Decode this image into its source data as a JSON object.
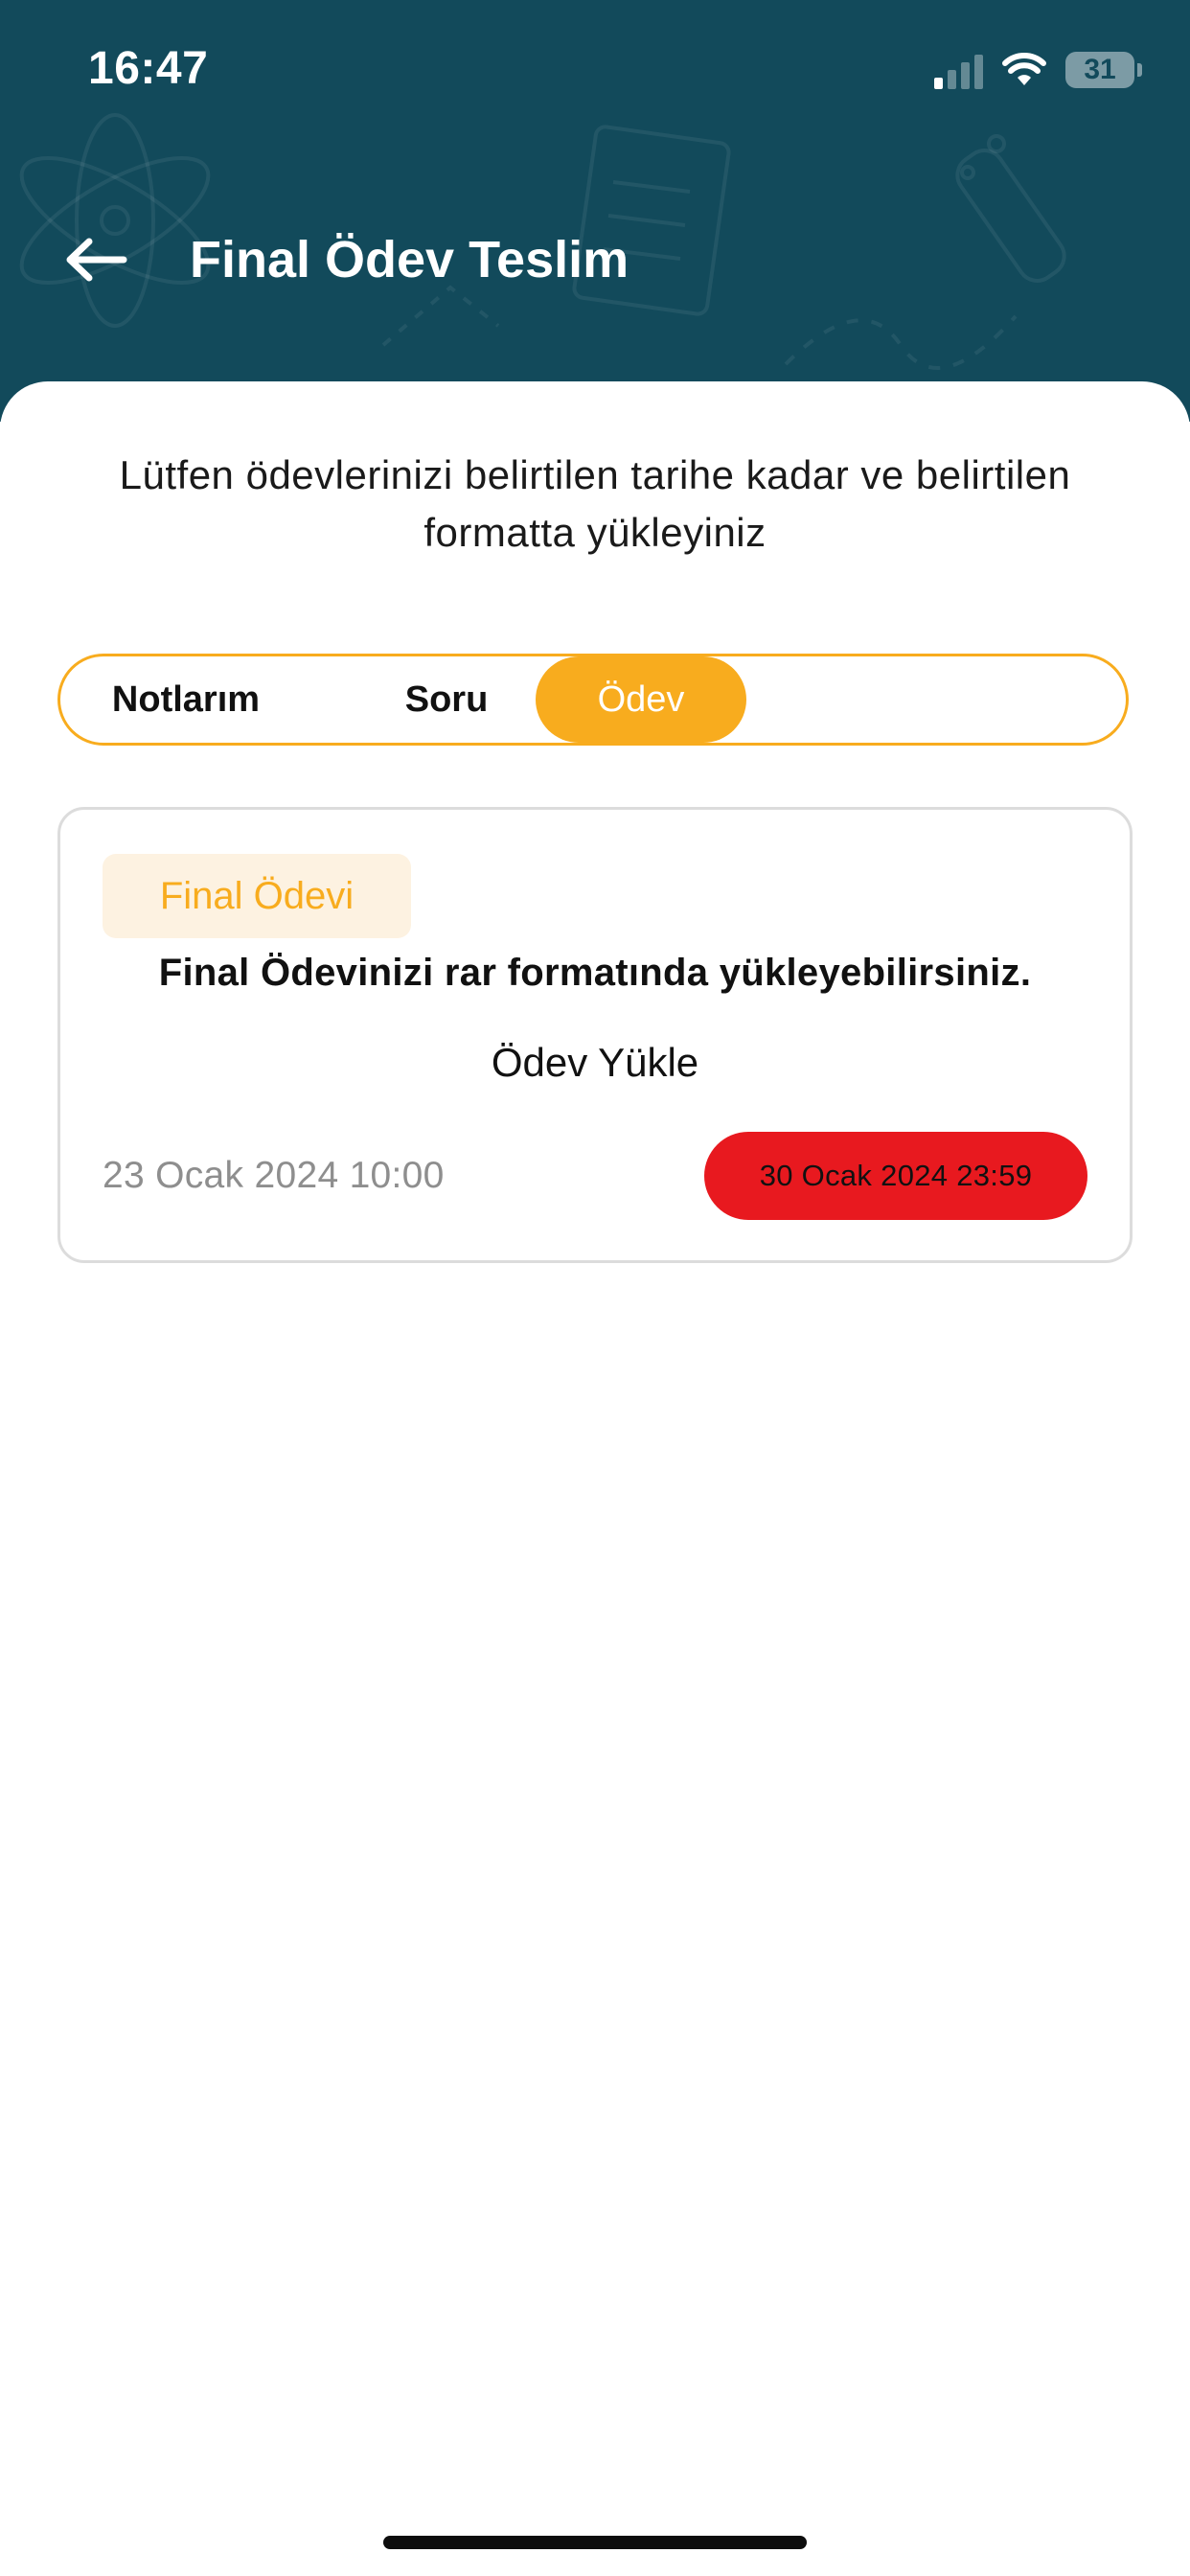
{
  "status_bar": {
    "time": "16:47",
    "battery": "31",
    "battery_level": 0.31,
    "signal_bars_on": 1,
    "signal_bars_total": 4
  },
  "header": {
    "back_icon": "arrow-left-icon",
    "title": "Final Ödev Teslim",
    "background_color": "#124a5b"
  },
  "intro_text": "Lütfen ödevlerinizi belirtilen tarihe kadar ve belirtilen formatta yükleyiniz",
  "tabs": [
    {
      "label": "Notlarım",
      "selected": false
    },
    {
      "label": "Soru",
      "selected": false
    },
    {
      "label": "Ödev",
      "selected": true
    }
  ],
  "accent_color": "#f8ac1e",
  "assignment_card": {
    "badge": "Final Ödevi",
    "description": "Final Ödevinizi rar formatında yükleyebilirsiniz.",
    "upload_label": "Ödev Yükle",
    "start_date": "23 Ocak 2024 10:00",
    "deadline": "30 Ocak 2024 23:59",
    "deadline_color": "#e8191f"
  }
}
